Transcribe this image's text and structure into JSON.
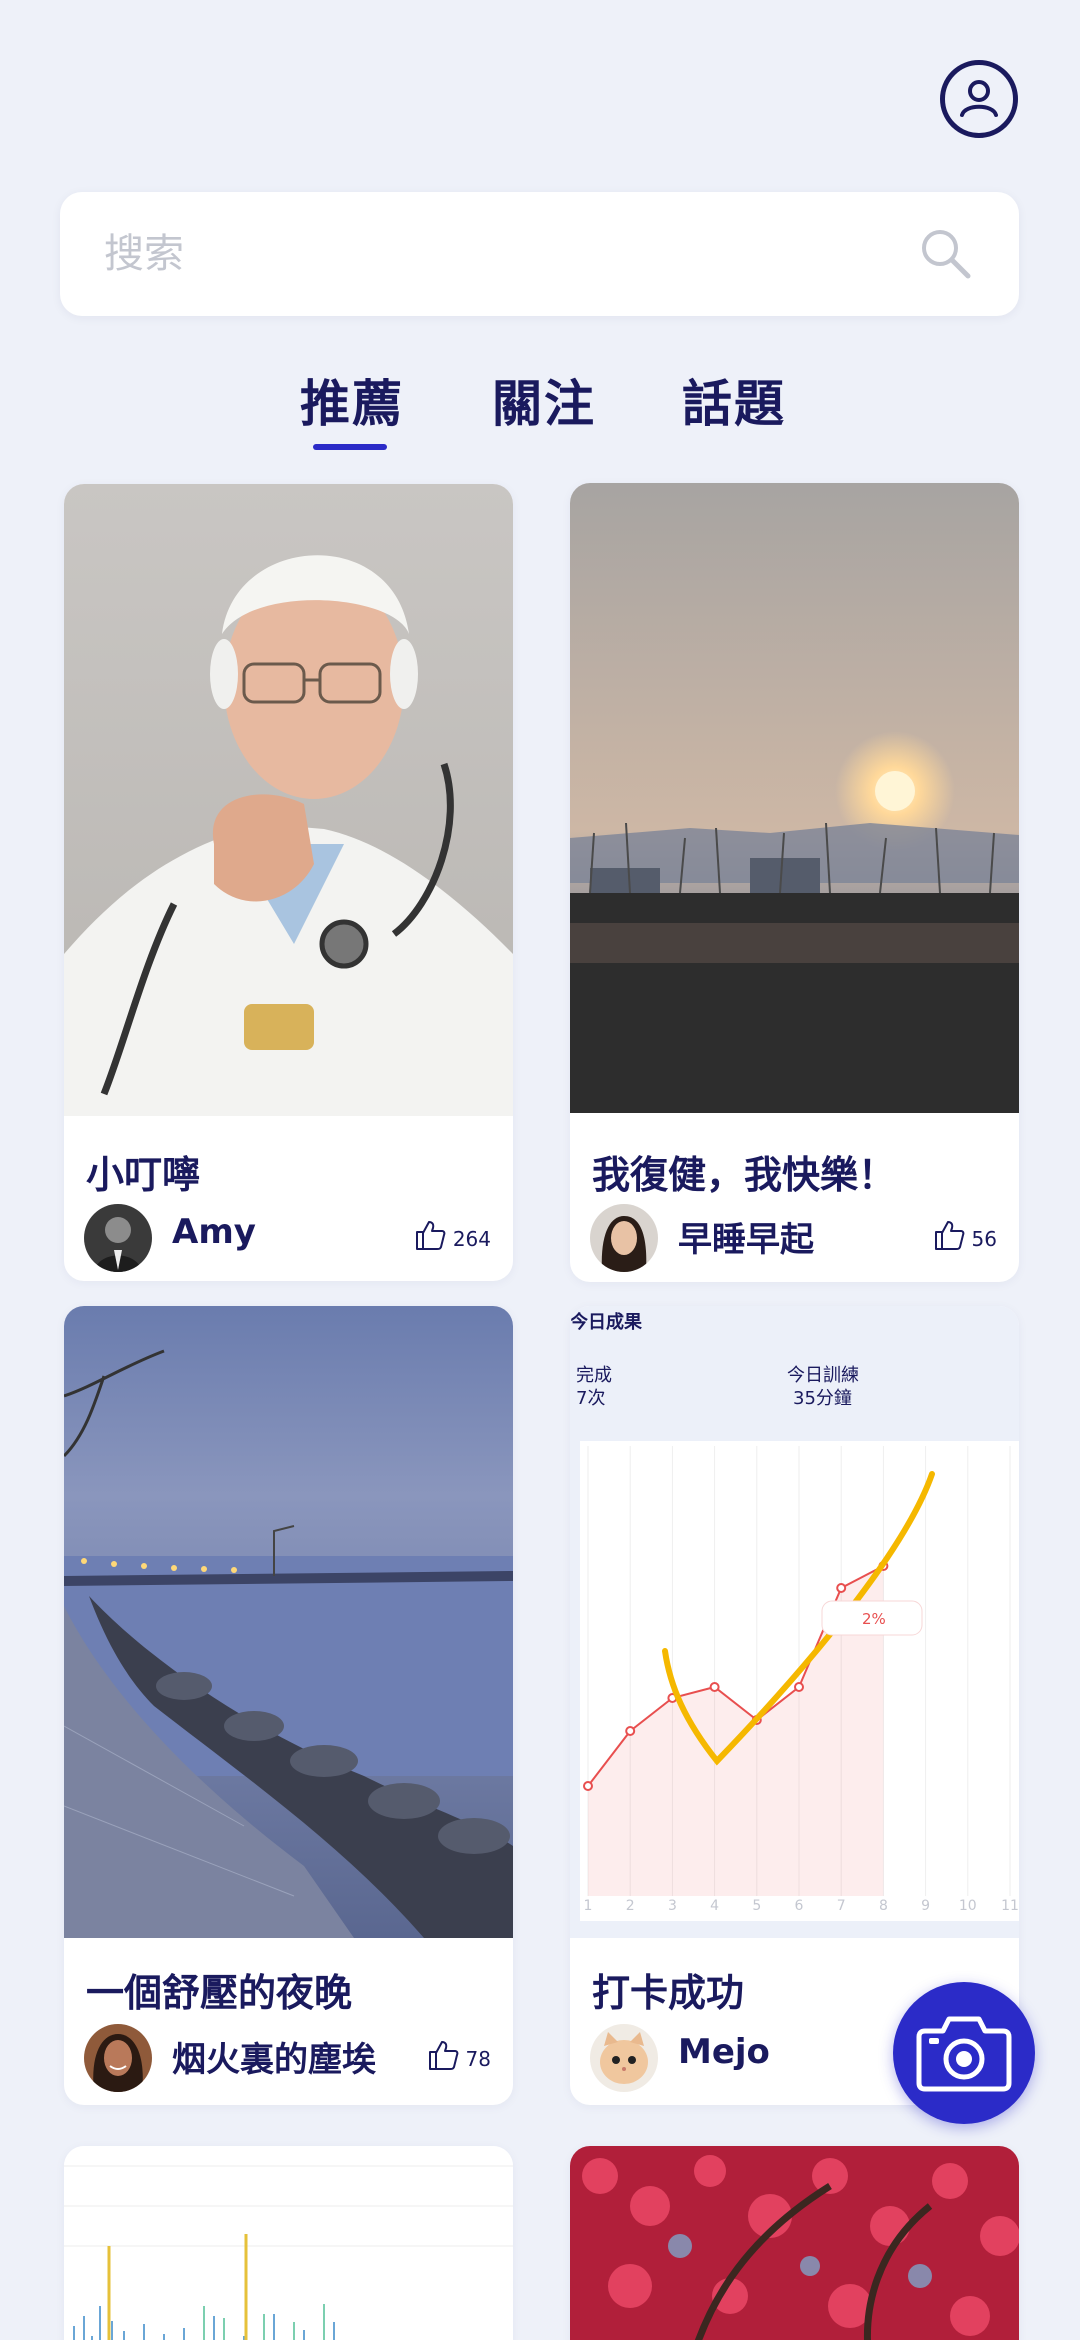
{
  "search": {
    "placeholder": "搜索"
  },
  "tabs": [
    {
      "label": "推薦",
      "active": true
    },
    {
      "label": "關注",
      "active": false
    },
    {
      "label": "話題",
      "active": false
    }
  ],
  "cards": [
    {
      "title": "小叮嚀",
      "author": "Amy",
      "likes": "264",
      "image": "elderly-doctor-photo"
    },
    {
      "title": "我復健，我快樂！",
      "author": "早睡早起",
      "likes": "56",
      "image": "sunset-reeds-photo"
    },
    {
      "title": "一個舒壓的夜晚",
      "author": "烟火裏的塵埃",
      "likes": "78",
      "image": "lakeside-evening-photo"
    },
    {
      "title": "打卡成功",
      "author": "Mejo",
      "likes": "",
      "image": "training-result-screenshot"
    }
  ],
  "result_card": {
    "heading": "今日成果",
    "done_label": "完成",
    "done_value": "7次",
    "training_label": "今日訓練",
    "training_value": "35分鐘",
    "badge": "2%",
    "x_ticks": [
      "1",
      "2",
      "3",
      "4",
      "5",
      "6",
      "7",
      "8",
      "9",
      "10",
      "11"
    ]
  },
  "chart_data": {
    "type": "line",
    "x": [
      1,
      2,
      3,
      4,
      5,
      6,
      7,
      8
    ],
    "series": [
      {
        "values": [
          10,
          15,
          18,
          19,
          16,
          19,
          28,
          30
        ]
      }
    ],
    "trend_color": "#f5b800",
    "line_color": "#e84f4f"
  },
  "icons": {
    "profile": "user-circle-icon",
    "search": "search-icon",
    "like": "thumbs-up-icon",
    "camera": "camera-icon"
  },
  "colors": {
    "background": "#eef1f9",
    "primary": "#1a1a5e",
    "accent": "#2b2bc8"
  }
}
